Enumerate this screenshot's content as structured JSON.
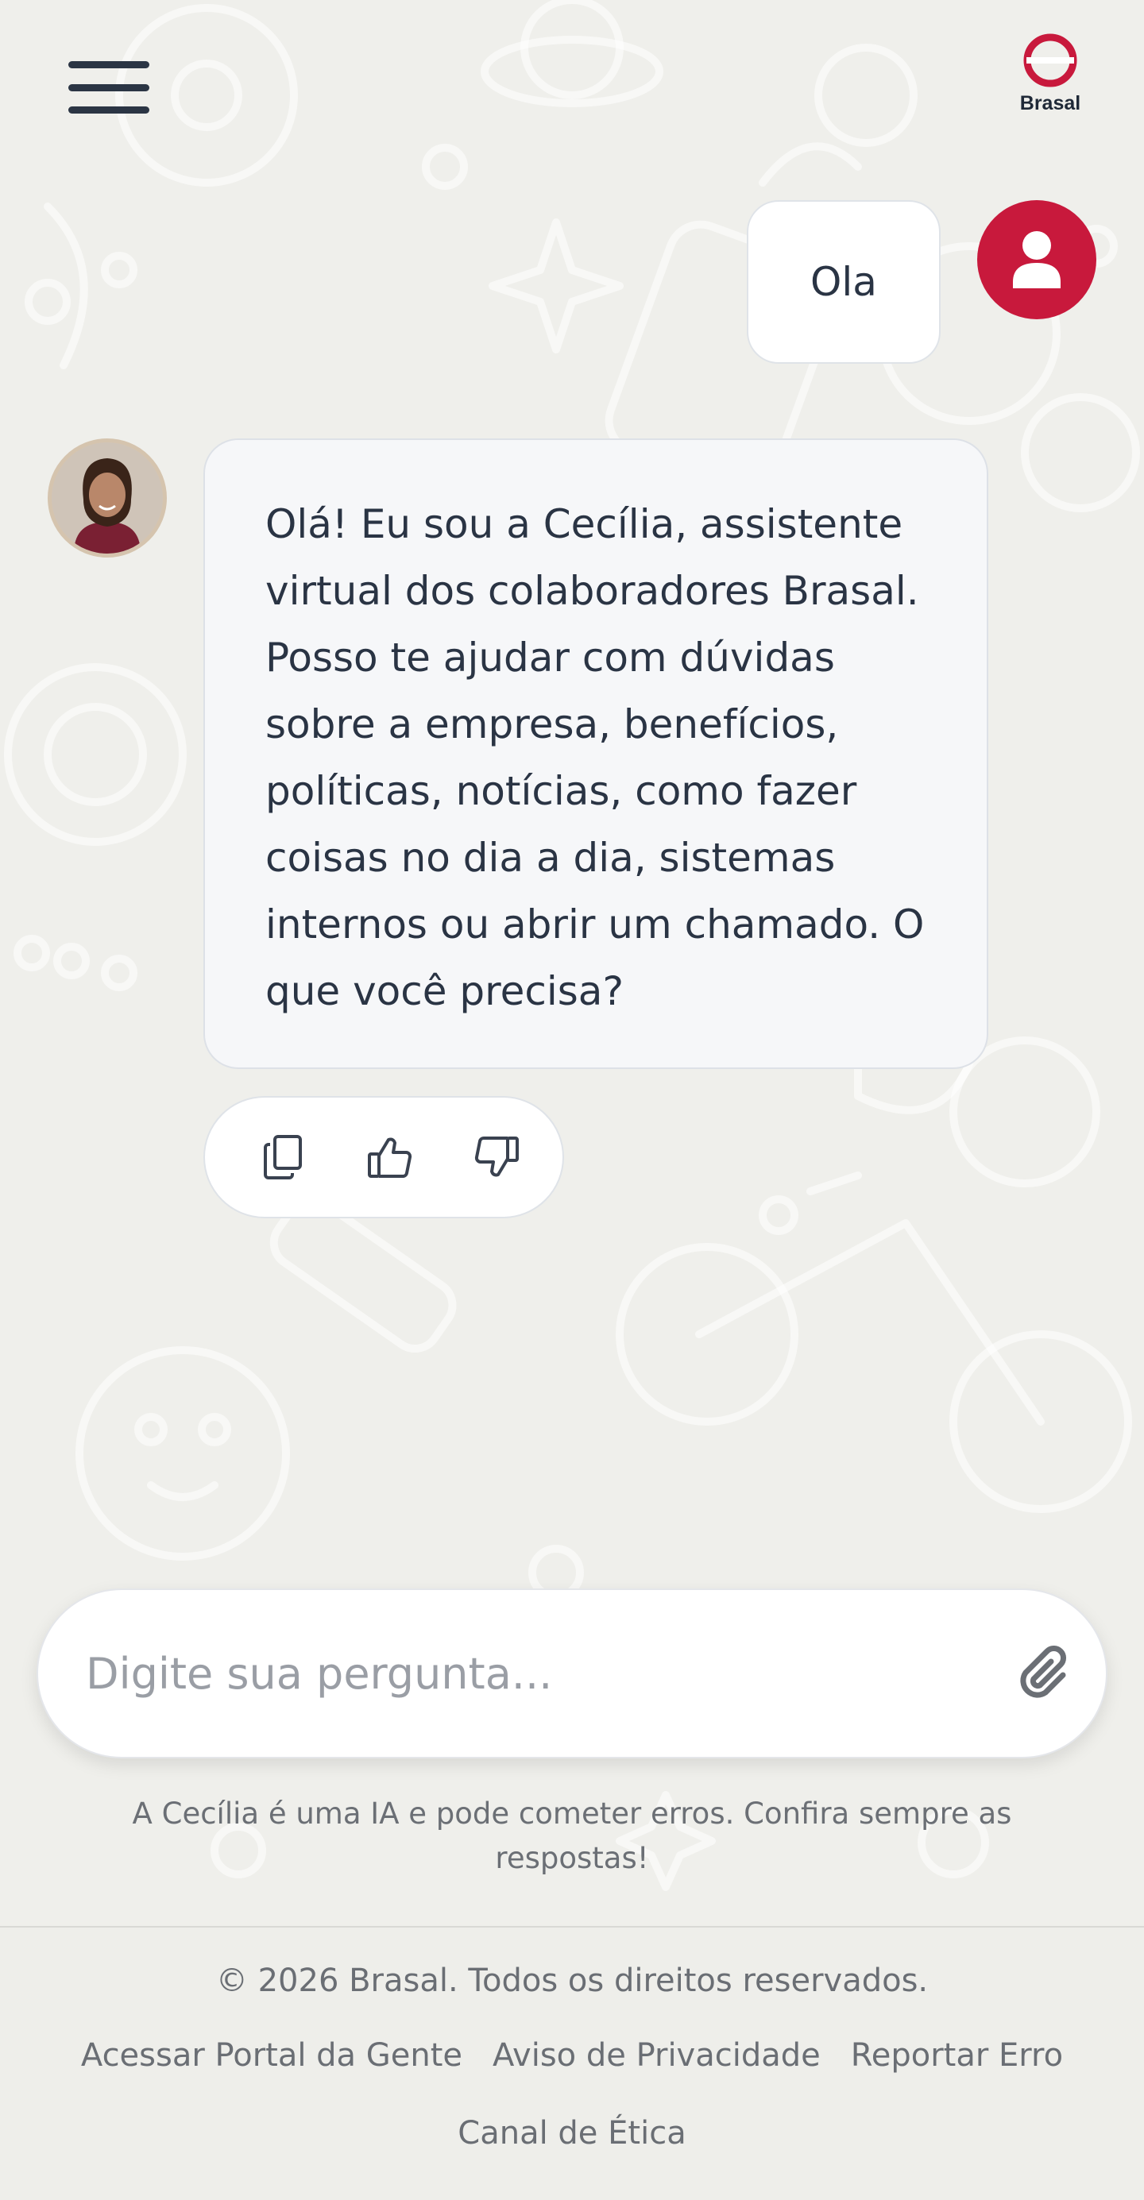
{
  "header": {
    "menu_icon": "hamburger-menu-icon",
    "logo_icon": "brasal-ring-logo",
    "logo_text": "Brasal",
    "brand_color": "#c8193c"
  },
  "chat": {
    "user_message": "Ola",
    "user_avatar_icon": "user-icon",
    "bot_avatar": "cecilia-avatar-photo",
    "bot_message": "Olá! Eu sou a Cecília, assistente virtual dos colaboradores Brasal. Posso te ajudar com dúvidas sobre a empresa, benefícios, políticas, notícias, como fazer coisas no dia a dia, sistemas internos ou abrir um chamado. O que você precisa?",
    "actions": [
      {
        "icon": "copy-icon"
      },
      {
        "icon": "thumbs-up-icon"
      },
      {
        "icon": "thumbs-down-icon"
      }
    ]
  },
  "input": {
    "placeholder": "Digite sua pergunta...",
    "value": "",
    "attach_icon": "paperclip-icon"
  },
  "disclaimer": "A Cecília é uma IA e pode cometer erros. Confira sempre as respostas!",
  "footer": {
    "copyright": "© 2026 Brasal. Todos os direitos reservados.",
    "links": [
      "Acessar Portal da Gente",
      "Aviso de Privacidade",
      "Reportar Erro",
      "Canal de Ética"
    ]
  }
}
